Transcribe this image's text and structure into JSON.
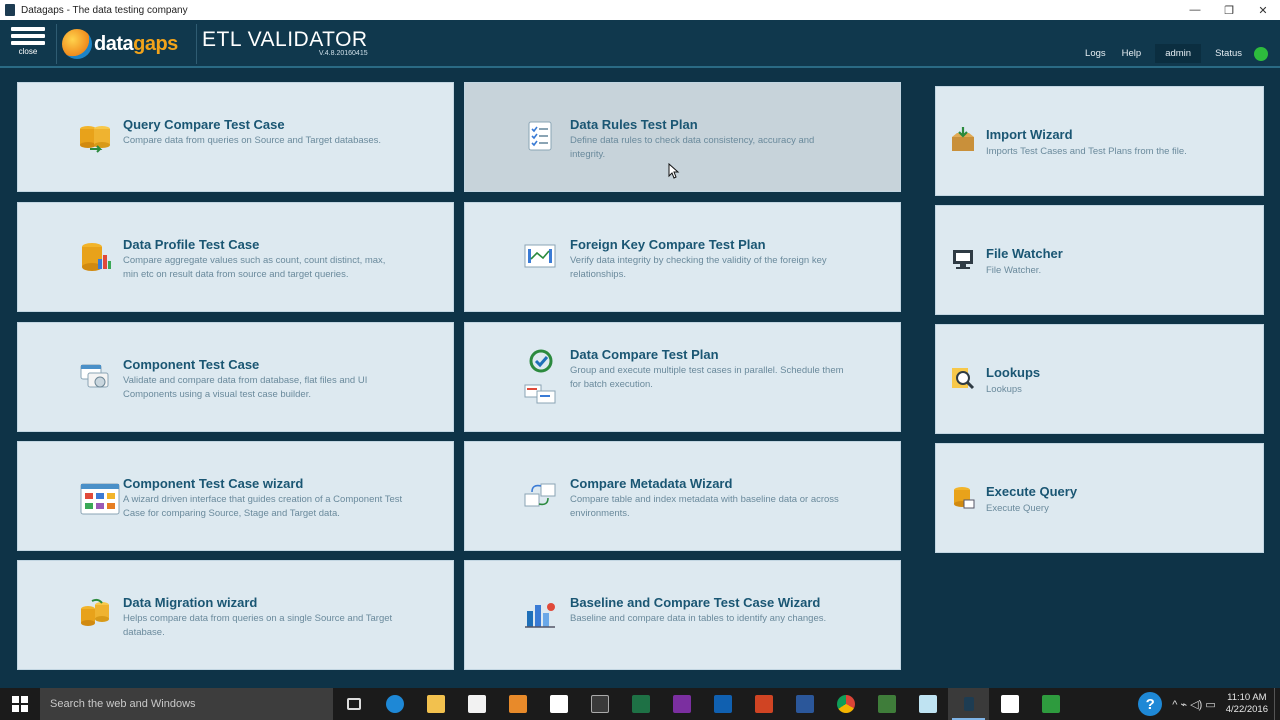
{
  "window": {
    "title": "Datagaps - The data testing company",
    "minimize": "—",
    "restore": "❐",
    "close": "✕"
  },
  "header": {
    "menu_label": "close",
    "logo_prefix": "data",
    "logo_suffix": "gaps",
    "product": "ETL VALIDATOR",
    "version": "V.4.8.20160415",
    "links": {
      "logs": "Logs",
      "help": "Help",
      "user": "admin",
      "status": "Status"
    },
    "status_color": "#2dbb3d"
  },
  "tiles": {
    "query_compare": {
      "title": "Query Compare Test Case",
      "desc": "Compare data from queries on Source and Target databases.",
      "icon": "database-compare-icon"
    },
    "data_profile": {
      "title": "Data Profile Test Case",
      "desc": "Compare aggregate values such as count, count distinct, max, min etc on result data from source and target queries.",
      "icon": "database-chart-icon"
    },
    "component": {
      "title": "Component Test Case",
      "desc": "Validate and compare data from database, flat files and UI Components using a visual test case builder.",
      "icon": "component-icon"
    },
    "component_wizard": {
      "title": "Component Test Case wizard",
      "desc": "A wizard driven interface that guides creation of a Component Test Case for comparing Source, Stage and Target data.",
      "icon": "wizard-grid-icon"
    },
    "data_migration": {
      "title": "Data Migration wizard",
      "desc": "Helps compare data from queries on a single Source and Target database.",
      "icon": "migration-icon"
    },
    "data_rules": {
      "title": "Data Rules Test Plan",
      "desc": "Define data rules to check data consistency, accuracy and integrity.",
      "icon": "checklist-icon"
    },
    "foreign_key": {
      "title": "Foreign Key Compare Test Plan",
      "desc": "Verify data integrity by checking the validity of the foreign key relationships.",
      "icon": "key-relation-icon"
    },
    "data_compare": {
      "title": "Data Compare Test Plan",
      "desc": "Group and execute multiple test cases in parallel. Schedule them for batch execution.",
      "icon": "refresh-compare-icon"
    },
    "metadata": {
      "title": "Compare Metadata Wizard",
      "desc": "Compare table and index metadata with baseline data or across environments.",
      "icon": "metadata-icon"
    },
    "baseline": {
      "title": "Baseline and Compare Test Case Wizard",
      "desc": "Baseline and compare data in tables to identify any changes.",
      "icon": "baseline-chart-icon"
    },
    "import_wizard": {
      "title": "Import Wizard",
      "desc": "Imports Test Cases and Test Plans from the file.",
      "icon": "import-box-icon"
    },
    "file_watcher": {
      "title": "File Watcher",
      "desc": "File Watcher.",
      "icon": "file-watcher-icon"
    },
    "lookups": {
      "title": "Lookups",
      "desc": "Lookups",
      "icon": "lookup-magnifier-icon"
    },
    "execute_query": {
      "title": "Execute Query",
      "desc": "Execute Query",
      "icon": "database-run-icon"
    }
  },
  "taskbar": {
    "search_placeholder": "Search the web and Windows",
    "time": "11:10 AM",
    "date": "4/22/2016",
    "help": "?",
    "tray_icons": "^  ⌁  ◁)  ▭"
  }
}
